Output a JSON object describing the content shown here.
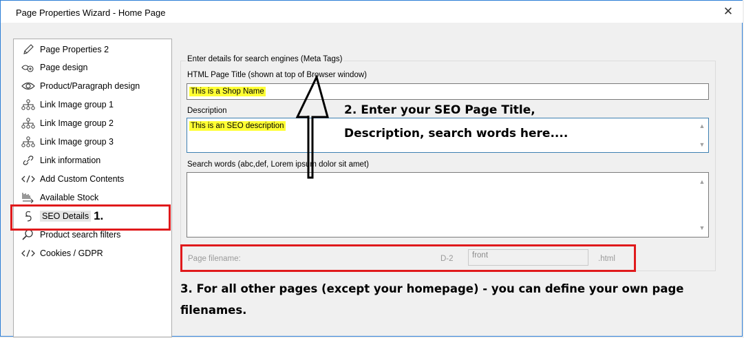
{
  "window": {
    "title": "Page Properties Wizard - Home Page",
    "close_glyph": "✕"
  },
  "sidebar": {
    "items": [
      {
        "label": "Page Properties 2",
        "icon": "pencil-icon"
      },
      {
        "label": "Page design",
        "icon": "design-icon"
      },
      {
        "label": "Product/Paragraph design",
        "icon": "eye-icon"
      },
      {
        "label": "Link Image group 1",
        "icon": "sitemap-icon"
      },
      {
        "label": "Link Image group 2",
        "icon": "sitemap-icon"
      },
      {
        "label": "Link Image group 3",
        "icon": "sitemap-icon"
      },
      {
        "label": "Link information",
        "icon": "link-icon"
      },
      {
        "label": "Add Custom Contents",
        "icon": "code-icon"
      },
      {
        "label": "Available Stock",
        "icon": "stock-icon"
      },
      {
        "label": "SEO Details",
        "icon": "seo-icon",
        "selected": true
      },
      {
        "label": "Product search filters",
        "icon": "search-icon"
      },
      {
        "label": "Cookies / GDPR",
        "icon": "code-icon"
      }
    ]
  },
  "form": {
    "group_title": "Enter details for search engines (Meta Tags)",
    "title_label": "HTML Page Title (shown at top of Browser window)",
    "title_value": "This is a Shop Name",
    "description_label": "Description",
    "description_value": "This is an SEO description",
    "search_words_label": "Search words (abc,def, Lorem ipsum dolor sit amet)",
    "search_words_value": "",
    "filename_label": "Page filename:",
    "filename_prefix": "D-2",
    "filename_value": "front",
    "filename_suffix": ".html"
  },
  "annotations": {
    "step1": "1.",
    "step2_line1": "2. Enter your SEO Page Title,",
    "step2_line2": "Description, search words here....",
    "step3_line1": "3. For all other pages (except your homepage) - you can define your own page",
    "step3_line2": "filenames.",
    "highlight_color": "#ffff33",
    "box_color": "#e0191b"
  }
}
